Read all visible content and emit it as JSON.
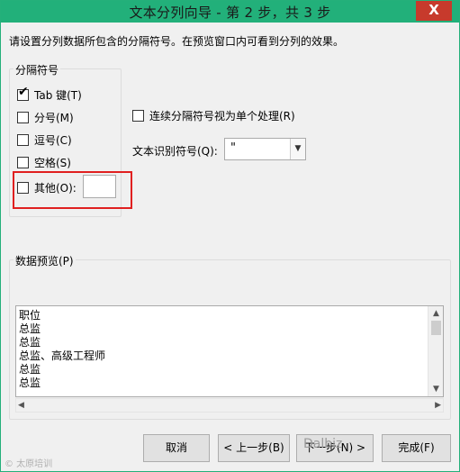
{
  "window": {
    "title": "文本分列向导 - 第 2 步，共 3 步",
    "close_label": "X"
  },
  "instruction": "请设置分列数据所包含的分隔符号。在预览窗口内可看到分列的效果。",
  "delimiters": {
    "group_label": "分隔符号",
    "tab": {
      "label": "Tab 键(T)",
      "checked": true
    },
    "semicolon": {
      "label": "分号(M)",
      "checked": false
    },
    "comma": {
      "label": "逗号(C)",
      "checked": false
    },
    "space": {
      "label": "空格(S)",
      "checked": false
    },
    "other": {
      "label": "其他(O):",
      "checked": false,
      "value": ""
    }
  },
  "consecutive": {
    "label": "连续分隔符号视为单个处理(R)",
    "checked": false
  },
  "text_qualifier": {
    "label": "文本识别符号(Q):",
    "value": "\""
  },
  "preview": {
    "group_label": "数据预览(P)",
    "lines": [
      "职位",
      "总监",
      "总监",
      "总监、高级工程师",
      "总监",
      "总监"
    ]
  },
  "buttons": {
    "cancel": "取消",
    "back": "< 上一步(B)",
    "next": "下一步(N) >",
    "finish": "完成(F)"
  },
  "watermark": {
    "left": "© 太原培训",
    "right": "Dalbiz"
  },
  "colors": {
    "titlebar": "#22b07a",
    "close": "#c73a2c",
    "highlight": "#e02020"
  }
}
